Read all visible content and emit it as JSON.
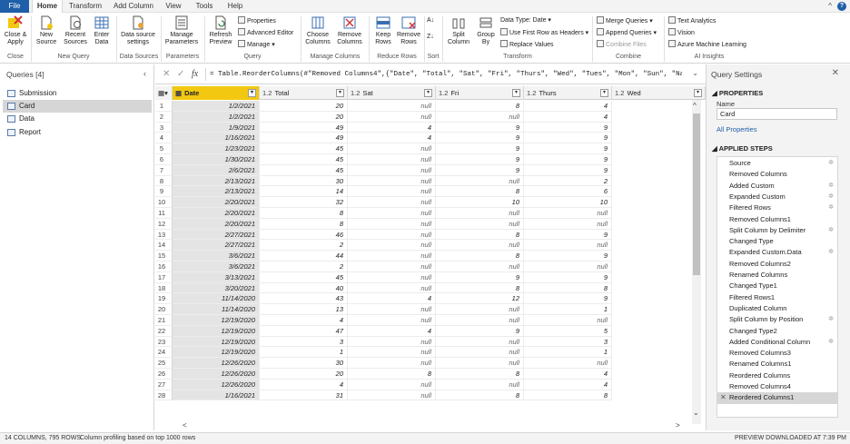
{
  "tabs": [
    "File",
    "Home",
    "Transform",
    "Add Column",
    "View",
    "Tools",
    "Help"
  ],
  "ribbon": {
    "close_apply": "Close &\nApply",
    "new_source": "New\nSource",
    "recent_sources": "Recent\nSources",
    "enter_data": "Enter\nData",
    "data_source_settings": "Data source\nsettings",
    "manage_parameters": "Manage\nParameters",
    "refresh_preview": "Refresh\nPreview",
    "properties": "Properties",
    "advanced_editor": "Advanced Editor",
    "manage": "Manage",
    "choose_columns": "Choose\nColumns",
    "remove_columns": "Remove\nColumns",
    "keep_rows": "Keep\nRows",
    "remove_rows": "Remove\nRows",
    "split_column": "Split\nColumn",
    "group_by": "Group\nBy",
    "data_type": "Data Type: Date",
    "first_row_headers": "Use First Row as Headers",
    "replace_values": "Replace Values",
    "merge_queries": "Merge Queries",
    "append_queries": "Append Queries",
    "combine_files": "Combine Files",
    "text_analytics": "Text Analytics",
    "vision": "Vision",
    "azure_ml": "Azure Machine Learning",
    "groups": [
      "Close",
      "New Query",
      "Data Sources",
      "Parameters",
      "Query",
      "Manage Columns",
      "Reduce Rows",
      "Sort",
      "Transform",
      "Combine",
      "AI Insights"
    ]
  },
  "queries": {
    "title": "Queries [4]",
    "items": [
      "Submission",
      "Card",
      "Data",
      "Report"
    ],
    "selected": "Card"
  },
  "formula": "= Table.ReorderColumns(#\"Removed Columns4\",{\"Date\", \"Total\", \"Sat\", \"Fri\", \"Thurs\", \"Wed\", \"Tues\", \"Mon\", \"Sun\", \"Name\",",
  "columns": [
    {
      "type": "",
      "name": "Date"
    },
    {
      "type": "1.2",
      "name": "Total"
    },
    {
      "type": "1.2",
      "name": "Sat"
    },
    {
      "type": "1.2",
      "name": "Fri"
    },
    {
      "type": "1.2",
      "name": "Thurs"
    },
    {
      "type": "1.2",
      "name": "Wed"
    }
  ],
  "rows": [
    [
      "1",
      "1/2/2021",
      "20",
      "null",
      "8",
      "4"
    ],
    [
      "2",
      "1/2/2021",
      "20",
      "null",
      "null",
      "4"
    ],
    [
      "3",
      "1/9/2021",
      "49",
      "4",
      "9",
      "9"
    ],
    [
      "4",
      "1/16/2021",
      "49",
      "4",
      "9",
      "9"
    ],
    [
      "5",
      "1/23/2021",
      "45",
      "null",
      "9",
      "9"
    ],
    [
      "6",
      "1/30/2021",
      "45",
      "null",
      "9",
      "9"
    ],
    [
      "7",
      "2/6/2021",
      "45",
      "null",
      "9",
      "9"
    ],
    [
      "8",
      "2/13/2021",
      "30",
      "null",
      "null",
      "2"
    ],
    [
      "9",
      "2/13/2021",
      "14",
      "null",
      "8",
      "6"
    ],
    [
      "10",
      "2/20/2021",
      "32",
      "null",
      "10",
      "10"
    ],
    [
      "11",
      "2/20/2021",
      "8",
      "null",
      "null",
      "null"
    ],
    [
      "12",
      "2/20/2021",
      "8",
      "null",
      "null",
      "null"
    ],
    [
      "13",
      "2/27/2021",
      "46",
      "null",
      "8",
      "9"
    ],
    [
      "14",
      "2/27/2021",
      "2",
      "null",
      "null",
      "null"
    ],
    [
      "15",
      "3/6/2021",
      "44",
      "null",
      "8",
      "9"
    ],
    [
      "16",
      "3/6/2021",
      "2",
      "null",
      "null",
      "null"
    ],
    [
      "17",
      "3/13/2021",
      "45",
      "null",
      "9",
      "9"
    ],
    [
      "18",
      "3/20/2021",
      "40",
      "null",
      "8",
      "8"
    ],
    [
      "19",
      "11/14/2020",
      "43",
      "4",
      "12",
      "9"
    ],
    [
      "20",
      "11/14/2020",
      "13",
      "null",
      "null",
      "1"
    ],
    [
      "21",
      "12/19/2020",
      "4",
      "null",
      "null",
      "null"
    ],
    [
      "22",
      "12/19/2020",
      "47",
      "4",
      "9",
      "5"
    ],
    [
      "23",
      "12/19/2020",
      "3",
      "null",
      "null",
      "3"
    ],
    [
      "24",
      "12/19/2020",
      "1",
      "null",
      "null",
      "1"
    ],
    [
      "25",
      "12/26/2020",
      "30",
      "null",
      "null",
      "null"
    ],
    [
      "26",
      "12/26/2020",
      "20",
      "8",
      "8",
      "4"
    ],
    [
      "27",
      "12/26/2020",
      "4",
      "null",
      "null",
      "4"
    ],
    [
      "28",
      "1/16/2021",
      "31",
      "null",
      "8",
      "8"
    ]
  ],
  "settings": {
    "title": "Query Settings",
    "properties_label": "PROPERTIES",
    "name_label": "Name",
    "name_value": "Card",
    "all_properties": "All Properties",
    "applied_steps_label": "APPLIED STEPS",
    "steps": [
      {
        "label": "Source",
        "gear": true
      },
      {
        "label": "Removed Columns",
        "gear": false
      },
      {
        "label": "Added Custom",
        "gear": true
      },
      {
        "label": "Expanded Custom",
        "gear": true
      },
      {
        "label": "Filtered Rows",
        "gear": true
      },
      {
        "label": "Removed Columns1",
        "gear": false
      },
      {
        "label": "Split Column by Delimiter",
        "gear": true
      },
      {
        "label": "Changed Type",
        "gear": false
      },
      {
        "label": "Expanded Custom.Data",
        "gear": true
      },
      {
        "label": "Removed Columns2",
        "gear": false
      },
      {
        "label": "Renamed Columns",
        "gear": false
      },
      {
        "label": "Changed Type1",
        "gear": false
      },
      {
        "label": "Filtered Rows1",
        "gear": false
      },
      {
        "label": "Duplicated Column",
        "gear": false
      },
      {
        "label": "Split Column by Position",
        "gear": true
      },
      {
        "label": "Changed Type2",
        "gear": false
      },
      {
        "label": "Added Conditional Column",
        "gear": true
      },
      {
        "label": "Removed Columns3",
        "gear": false
      },
      {
        "label": "Renamed Columns1",
        "gear": false
      },
      {
        "label": "Reordered Columns",
        "gear": false
      },
      {
        "label": "Removed Columns4",
        "gear": false
      },
      {
        "label": "Reordered Columns1",
        "gear": false
      }
    ]
  },
  "status": {
    "left": "14 COLUMNS, 795 ROWS",
    "profiling": "Column profiling based on top 1000 rows",
    "right": "PREVIEW DOWNLOADED AT 7:39 PM"
  }
}
